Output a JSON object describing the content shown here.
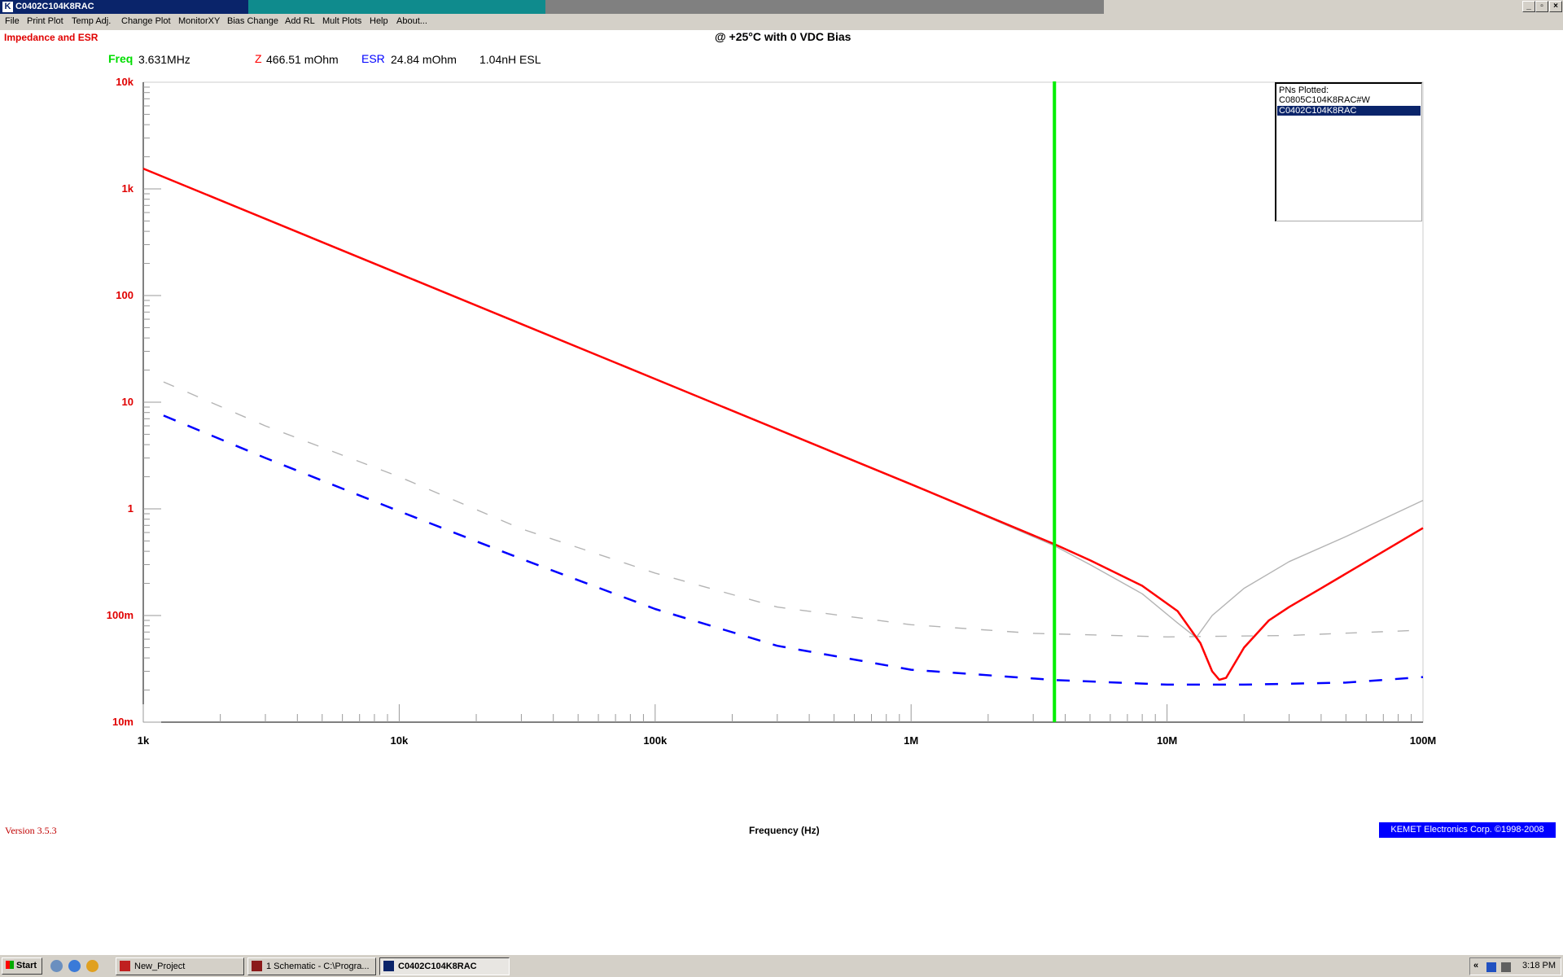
{
  "window": {
    "title": "C0402C104K8RAC",
    "icon_letter": "K",
    "controls": [
      "_",
      "▫",
      "×"
    ]
  },
  "menu": [
    "File",
    "Print Plot",
    "Temp Adj.",
    "Change Plot",
    "MonitorXY",
    "Bias Change",
    "Add RL",
    "Mult Plots",
    "Help",
    "About..."
  ],
  "header": {
    "plot_type": "Impedance and ESR",
    "bias": "@ +25°C with 0 VDC Bias"
  },
  "readout": {
    "freq_label": "Freq",
    "freq_value": "3.631MHz",
    "z_label": "Z",
    "z_value": "466.51 mOhm",
    "esr_label": "ESR",
    "esr_value": "24.84 mOhm",
    "esl_value": "1.04nH ESL"
  },
  "colors": {
    "impedance": "#ff0000",
    "esr": "#0000ff",
    "cursor": "#00ee00",
    "compare_trace": "#b4b4b4",
    "axis_label": "#e00000"
  },
  "legend": {
    "title": "PNs Plotted:",
    "items": [
      "C0805C104K8RAC#W",
      "C0402C104K8RAC"
    ],
    "selected_index": 1
  },
  "footer": {
    "version": "Version 3.5.3",
    "x_axis_title": "Frequency (Hz)",
    "copyright": "KEMET Electronics Corp. ©1998-2008"
  },
  "chart_data": {
    "type": "line",
    "title": "Impedance and ESR",
    "subtitle": "@ +25°C with 0 VDC Bias",
    "xlabel": "Frequency (Hz)",
    "ylabel": "",
    "x_scale": "log",
    "y_scale": "log",
    "xlim": [
      1000,
      100000000
    ],
    "ylim": [
      0.01,
      10000
    ],
    "x_ticks": [
      1000,
      10000,
      100000,
      1000000,
      10000000,
      100000000
    ],
    "x_tick_labels": [
      "1k",
      "10k",
      "100k",
      "1M",
      "10M",
      "100M"
    ],
    "y_ticks": [
      10000,
      1000,
      100,
      10,
      1,
      0.1,
      0.01
    ],
    "y_tick_labels": [
      "10k",
      "1k",
      "100",
      "10",
      "1",
      "100m",
      "10m"
    ],
    "grid": false,
    "legend_position": "top-right",
    "cursor_x": 3631000,
    "series": [
      {
        "name": "Z",
        "part": "C0402C104K8RAC",
        "style": "solid",
        "x": [
          1000,
          10000,
          100000,
          1000000,
          3631000,
          5000000,
          8000000,
          11000000,
          13500000,
          15000000,
          16000000,
          17000000,
          20000000,
          25000000,
          30000000,
          40000000,
          60000000,
          100000000
        ],
        "y": [
          1550,
          160,
          16.5,
          1.7,
          0.4665,
          0.33,
          0.19,
          0.11,
          0.055,
          0.03,
          0.025,
          0.026,
          0.05,
          0.09,
          0.12,
          0.18,
          0.32,
          0.66
        ]
      },
      {
        "name": "ESR",
        "part": "C0402C104K8RAC",
        "style": "dashed",
        "x": [
          1200,
          3000,
          10000,
          30000,
          100000,
          300000,
          1000000,
          3631000,
          10000000,
          20000000,
          50000000,
          100000000
        ],
        "y": [
          7.5,
          3.0,
          0.95,
          0.34,
          0.115,
          0.052,
          0.031,
          0.02484,
          0.0225,
          0.0225,
          0.0235,
          0.0265
        ]
      },
      {
        "name": "Z",
        "part": "C0805C104K8RAC#W",
        "style": "solid",
        "x": [
          1000,
          10000,
          100000,
          1000000,
          3631000,
          5000000,
          8000000,
          11000000,
          13000000,
          15000000,
          20000000,
          30000000,
          50000000,
          100000000
        ],
        "y": [
          1550,
          160,
          16.5,
          1.7,
          0.45,
          0.3,
          0.16,
          0.085,
          0.062,
          0.1,
          0.18,
          0.32,
          0.55,
          1.2
        ]
      },
      {
        "name": "ESR",
        "part": "C0805C104K8RAC#W",
        "style": "dashed",
        "x": [
          1200,
          3000,
          10000,
          30000,
          100000,
          300000,
          1000000,
          3000000,
          10000000,
          30000000,
          100000000
        ],
        "y": [
          15.5,
          6.0,
          2.0,
          0.65,
          0.25,
          0.12,
          0.082,
          0.068,
          0.063,
          0.065,
          0.073
        ]
      }
    ]
  },
  "taskbar": {
    "start_label": "Start",
    "tasks": [
      {
        "label": "New_Project",
        "active": false
      },
      {
        "label": "1 Schematic - C:\\Progra...",
        "active": false
      },
      {
        "label": "C0402C104K8RAC",
        "active": true
      }
    ],
    "clock": "3:18 PM"
  }
}
